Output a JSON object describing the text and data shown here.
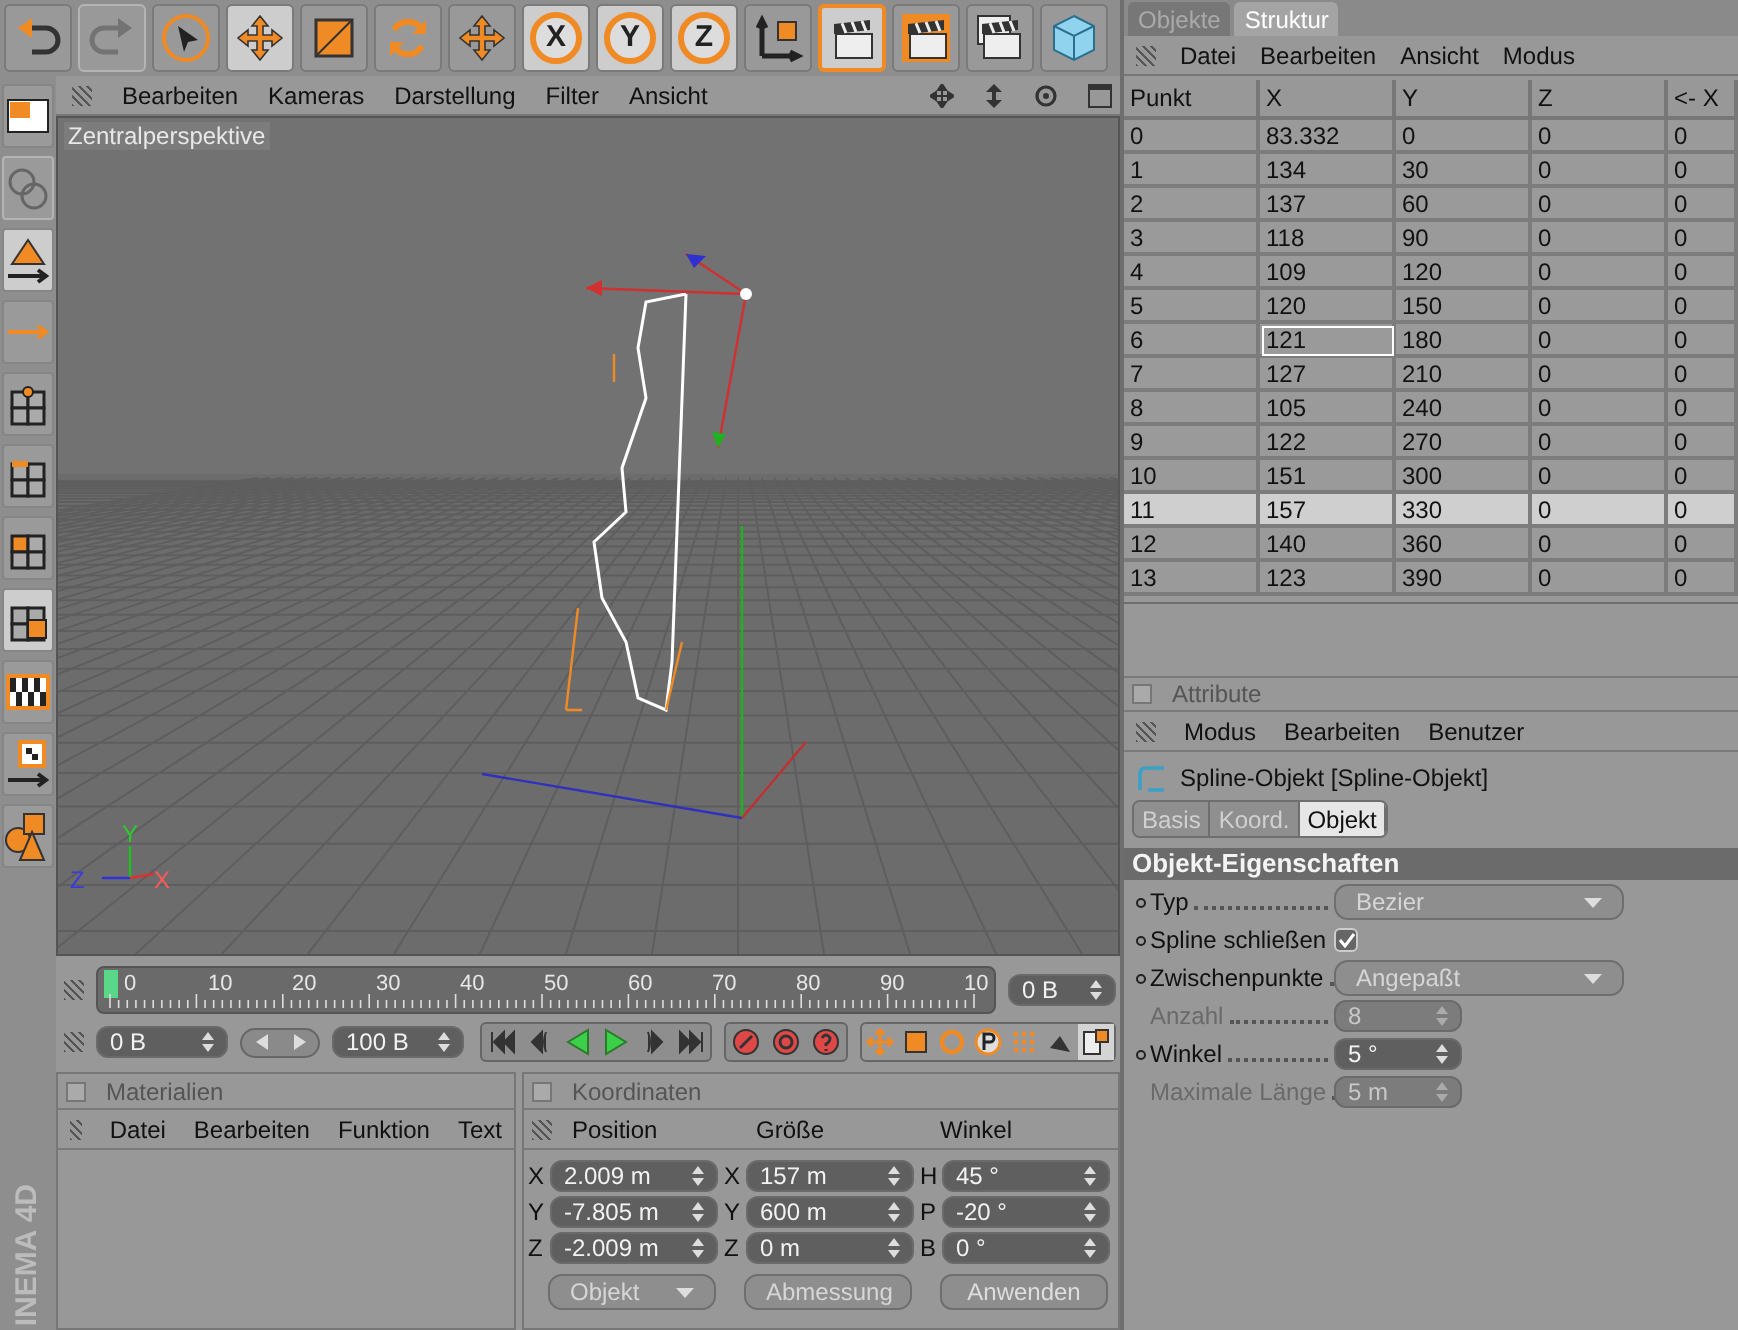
{
  "toolbar": [
    {
      "kind": "undo",
      "selected": false,
      "disabled": false
    },
    {
      "kind": "redo",
      "selected": false,
      "disabled": true
    },
    {
      "kind": "select",
      "selected": false,
      "disabled": false
    },
    {
      "kind": "move",
      "selected": true,
      "disabled": false
    },
    {
      "kind": "scale",
      "selected": false,
      "disabled": false
    },
    {
      "kind": "rotate",
      "selected": false,
      "disabled": false
    },
    {
      "kind": "move",
      "selected": false,
      "disabled": false
    },
    {
      "kind": "axis",
      "label": "X",
      "selected": true,
      "disabled": false
    },
    {
      "kind": "axis",
      "label": "Y",
      "selected": true,
      "disabled": false
    },
    {
      "kind": "axis",
      "label": "Z",
      "selected": true,
      "disabled": false
    },
    {
      "kind": "coords",
      "selected": false,
      "disabled": false
    },
    {
      "kind": "render",
      "selected": true,
      "disabled": false
    },
    {
      "kind": "render-view",
      "selected": false,
      "disabled": false
    },
    {
      "kind": "render-settings",
      "selected": false,
      "disabled": false
    },
    {
      "kind": "cube",
      "selected": false,
      "disabled": false
    }
  ],
  "left_tools": [
    {
      "kind": "grid",
      "selected": false,
      "disabled": false
    },
    {
      "kind": "spheres",
      "selected": false,
      "disabled": true
    },
    {
      "kind": "triangle",
      "selected": true,
      "disabled": false
    },
    {
      "kind": "arrow",
      "selected": false,
      "disabled": false
    },
    {
      "kind": "points",
      "selected": false,
      "disabled": false
    },
    {
      "kind": "edges",
      "selected": false,
      "disabled": false
    },
    {
      "kind": "polygons",
      "selected": false,
      "disabled": false
    },
    {
      "kind": "uv",
      "selected": true,
      "disabled": false
    },
    {
      "kind": "checker",
      "selected": false,
      "disabled": false
    },
    {
      "kind": "checker-small",
      "selected": false,
      "disabled": false
    },
    {
      "kind": "shapes",
      "selected": false,
      "disabled": false
    }
  ],
  "logo": "INEMA 4D",
  "viewport": {
    "menu": [
      "Bearbeiten",
      "Kameras",
      "Darstellung",
      "Filter",
      "Ansicht"
    ],
    "camera_label": "Zentralperspektive",
    "axis_labels": [
      {
        "label": "Y",
        "color": "#2ec82e"
      },
      {
        "label": "Z",
        "color": "#3a3ae0"
      },
      {
        "label": "X",
        "color": "#ff5a5a"
      }
    ]
  },
  "timeline": {
    "labels": [
      "0",
      "10",
      "20",
      "30",
      "40",
      "50",
      "60",
      "70",
      "80",
      "90",
      "10"
    ],
    "playhead": {
      "level": 0
    },
    "frame": "0 B"
  },
  "controls": {
    "start": "0 B",
    "end": "100 B",
    "transport": [
      {
        "kind": "first"
      },
      {
        "kind": "prev-key"
      },
      {
        "kind": "play-back"
      },
      {
        "kind": "play"
      },
      {
        "kind": "next-key"
      },
      {
        "kind": "last"
      }
    ],
    "record": [
      {
        "kind": "record"
      },
      {
        "kind": "autokey"
      },
      {
        "kind": "help"
      }
    ],
    "tools": [
      {
        "kind": "move",
        "selected": false
      },
      {
        "kind": "scale",
        "selected": false
      },
      {
        "kind": "rotate",
        "selected": false
      },
      {
        "kind": "param",
        "selected": false
      },
      {
        "kind": "points",
        "selected": false
      },
      {
        "kind": "bell",
        "selected": false
      },
      {
        "kind": "doc",
        "selected": true
      }
    ]
  },
  "materials": {
    "title": "Materialien",
    "menu": [
      "Datei",
      "Bearbeiten",
      "Funktion",
      "Text"
    ]
  },
  "coordinates": {
    "title": "Koordinaten",
    "headers": [
      "Position",
      "Größe",
      "Winkel"
    ],
    "columns": [
      [
        {
          "axis": "X",
          "value": "2.009 m"
        },
        {
          "axis": "Y",
          "value": "-7.805 m"
        },
        {
          "axis": "Z",
          "value": "-2.009 m"
        }
      ],
      [
        {
          "axis": "X",
          "value": "157 m"
        },
        {
          "axis": "Y",
          "value": "600 m"
        },
        {
          "axis": "Z",
          "value": "0 m"
        }
      ],
      [
        {
          "axis": "H",
          "value": "45 °"
        },
        {
          "axis": "P",
          "value": "-20 °"
        },
        {
          "axis": "B",
          "value": "0 °"
        }
      ]
    ],
    "dropdowns": [
      "Objekt",
      "Abmessung"
    ],
    "apply": "Anwenden"
  },
  "objects_panel": {
    "tabs": [
      {
        "label": "Objekte",
        "selected": false
      },
      {
        "label": "Struktur",
        "selected": true
      }
    ],
    "menu": [
      "Datei",
      "Bearbeiten",
      "Ansicht",
      "Modus"
    ],
    "columns": [
      "Punkt",
      "X",
      "Y",
      "Z",
      "<- X"
    ],
    "rows": [
      {
        "cells": [
          "0",
          "83.332",
          "0",
          "0",
          "0"
        ],
        "selected": false,
        "editing": false
      },
      {
        "cells": [
          "1",
          "134",
          "30",
          "0",
          "0"
        ],
        "selected": false,
        "editing": false
      },
      {
        "cells": [
          "2",
          "137",
          "60",
          "0",
          "0"
        ],
        "selected": false,
        "editing": false
      },
      {
        "cells": [
          "3",
          "118",
          "90",
          "0",
          "0"
        ],
        "selected": false,
        "editing": false
      },
      {
        "cells": [
          "4",
          "109",
          "120",
          "0",
          "0"
        ],
        "selected": false,
        "editing": false
      },
      {
        "cells": [
          "5",
          "120",
          "150",
          "0",
          "0"
        ],
        "selected": false,
        "editing": false
      },
      {
        "cells": [
          "6",
          "121",
          "180",
          "0",
          "0"
        ],
        "selected": false,
        "editing": true
      },
      {
        "cells": [
          "7",
          "127",
          "210",
          "0",
          "0"
        ],
        "selected": false,
        "editing": false
      },
      {
        "cells": [
          "8",
          "105",
          "240",
          "0",
          "0"
        ],
        "selected": false,
        "editing": false
      },
      {
        "cells": [
          "9",
          "122",
          "270",
          "0",
          "0"
        ],
        "selected": false,
        "editing": false
      },
      {
        "cells": [
          "10",
          "151",
          "300",
          "0",
          "0"
        ],
        "selected": false,
        "editing": false
      },
      {
        "cells": [
          "11",
          "157",
          "330",
          "0",
          "0"
        ],
        "selected": true,
        "editing": false
      },
      {
        "cells": [
          "12",
          "140",
          "360",
          "0",
          "0"
        ],
        "selected": false,
        "editing": false
      },
      {
        "cells": [
          "13",
          "123",
          "390",
          "0",
          "0"
        ],
        "selected": false,
        "editing": false
      }
    ]
  },
  "attributes": {
    "title": "Attribute",
    "menu": [
      "Modus",
      "Bearbeiten",
      "Benutzer"
    ],
    "object": "Spline-Objekt [Spline-Objekt]",
    "tabs": [
      {
        "label": "Basis",
        "selected": false
      },
      {
        "label": "Koord.",
        "selected": false
      },
      {
        "label": "Objekt",
        "selected": true
      }
    ],
    "section": "Objekt-Eigenschaften",
    "fields": [
      {
        "kind": "dropdown",
        "label": "Typ",
        "value": "Bezier",
        "disabled": false
      },
      {
        "kind": "checkbox",
        "label": "Spline schließen",
        "checked": true,
        "disabled": false
      },
      {
        "kind": "dropdown",
        "label": "Zwischenpunkte",
        "value": "Angepaßt",
        "disabled": false
      },
      {
        "kind": "spinner",
        "label": "Anzahl",
        "value": "8",
        "disabled": true
      },
      {
        "kind": "spinner",
        "label": "Winkel",
        "value": "5 °",
        "disabled": false
      },
      {
        "kind": "spinner",
        "label": "Maximale Länge",
        "value": "5 m",
        "disabled": true
      }
    ]
  }
}
